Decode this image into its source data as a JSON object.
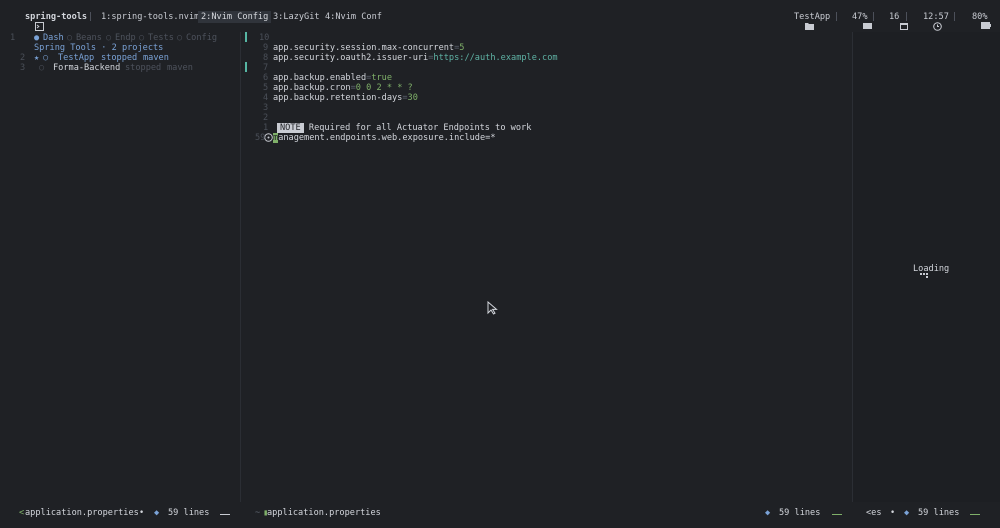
{
  "tmux": {
    "session": "spring-tools",
    "windows": [
      {
        "label": "1:spring-tools.nvim",
        "active": false
      },
      {
        "label": "2:Nvim Config",
        "active": true
      },
      {
        "label": "3:LazyGit",
        "active": false
      },
      {
        "label": "4:Nvim Conf",
        "active": false
      }
    ],
    "right": {
      "project": "TestApp",
      "cpu": "47%",
      "date": "16",
      "time": "12:57",
      "battery": "80%"
    }
  },
  "dashboard": {
    "tabs": [
      "Dash",
      "Beans",
      "Endp",
      "Tests",
      "Config"
    ],
    "line_numbers": [
      "1",
      "2",
      "3"
    ],
    "header": "Spring Tools · 2 projects",
    "projects": [
      {
        "marker": "★",
        "name": "TestApp",
        "status": "stopped",
        "build": "maven"
      },
      {
        "marker": "",
        "name": "Forma-Backend",
        "status": "stopped",
        "build": "maven"
      }
    ]
  },
  "editor": {
    "lines": [
      {
        "num": "10",
        "key": "",
        "value": ""
      },
      {
        "num": "9",
        "key": "app.security.session.max-concurrent",
        "value": "5"
      },
      {
        "num": "8",
        "key": "app.security.oauth2.issuer-uri",
        "value": "https://auth.example.com"
      },
      {
        "num": "7",
        "key": "",
        "value": ""
      },
      {
        "num": "6",
        "key": "app.backup.enabled",
        "value": "true"
      },
      {
        "num": "5",
        "key": "app.backup.cron",
        "value": "0 0 2 * * ?"
      },
      {
        "num": "4",
        "key": "app.backup.retention-days",
        "value": "30"
      },
      {
        "num": "3",
        "key": "",
        "value": ""
      },
      {
        "num": "2",
        "key": "",
        "value": ""
      }
    ],
    "note": {
      "num": "1",
      "badge": "NOTE",
      "text": "Required for all Actuator Endpoints to work"
    },
    "current": {
      "num": "59",
      "cursor_char": "m",
      "rest": "anagement.endpoints.web.exposure.include=*"
    }
  },
  "loading": {
    "text": "Loading"
  },
  "statusline": {
    "left": {
      "file": "application.properties",
      "lines": "59 lines"
    },
    "mid": {
      "file": "application.properties",
      "lines": "59 lines"
    },
    "right": {
      "file": "<es",
      "lines": "59 lines"
    }
  }
}
